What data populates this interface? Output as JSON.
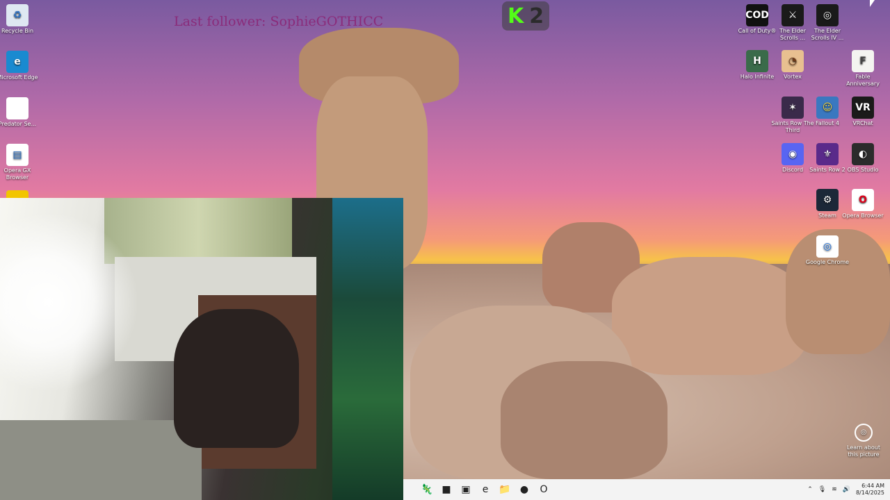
{
  "overlay": {
    "last_follower": "Last follower: SophieGOTHICC",
    "badge_letter": "K",
    "badge_number": "2"
  },
  "desktop_left": [
    {
      "label": "Recycle Bin",
      "icon": "recycle-bin-icon",
      "glyph": "♻",
      "bg": "#dfe8f2",
      "fg": "#2a72c8"
    },
    {
      "label": "Microsoft Edge",
      "icon": "edge-icon",
      "glyph": "e",
      "bg": "#1a8ad0",
      "fg": "#ffffff"
    },
    {
      "label": "Predator Se...",
      "icon": "file-icon",
      "glyph": "",
      "bg": "#ffffff",
      "fg": "#333333"
    },
    {
      "label": "Opera GX Browser",
      "icon": "opera-gx-icon",
      "glyph": "▤",
      "bg": "#ffffff",
      "fg": "#2a72c8"
    },
    {
      "label": "",
      "icon": "app-icon",
      "glyph": "✓",
      "bg": "#f2c500",
      "fg": "#222222"
    }
  ],
  "desktop_right": [
    {
      "label": "Call of Duty®",
      "icon": "call-of-duty-icon",
      "glyph": "COD",
      "bg": "#111111",
      "fg": "#ffffff"
    },
    {
      "label": "The Elder Scrolls ...",
      "icon": "elder-scrolls-skyrim-icon",
      "glyph": "⚔",
      "bg": "#1a1a1a",
      "fg": "#ffffff"
    },
    {
      "label": "The Elder Scrolls IV ...",
      "icon": "elder-scrolls-oblivion-icon",
      "glyph": "◎",
      "bg": "#1a1a1a",
      "fg": "#ffffff"
    },
    {
      "label": "Halo Infinite",
      "icon": "halo-infinite-icon",
      "glyph": "H",
      "bg": "#3a6b4a",
      "fg": "#ffffff"
    },
    {
      "label": "Vortex",
      "icon": "vortex-icon",
      "glyph": "◔",
      "bg": "#e8c090",
      "fg": "#6b3a1a"
    },
    {
      "label": "Fable Anniversary",
      "icon": "fable-icon",
      "glyph": "F",
      "bg": "#f4f4f0",
      "fg": "#444444"
    },
    {
      "label": "Saints Row The Third",
      "icon": "saints-row-third-icon",
      "glyph": "✶",
      "bg": "#3a2a4a",
      "fg": "#ffffff"
    },
    {
      "label": "Fallout 4",
      "icon": "fallout-4-icon",
      "glyph": "☺",
      "bg": "#3a78c0",
      "fg": "#f2d640"
    },
    {
      "label": "VRChat",
      "icon": "vrchat-icon",
      "glyph": "VR",
      "bg": "#1a1a1a",
      "fg": "#ffffff"
    },
    {
      "label": "Discord",
      "icon": "discord-icon",
      "glyph": "◉",
      "bg": "#5865f2",
      "fg": "#ffffff"
    },
    {
      "label": "Saints Row 2",
      "icon": "saints-row-2-icon",
      "glyph": "⚜",
      "bg": "#5a2a8a",
      "fg": "#ffffff"
    },
    {
      "label": "OBS Studio",
      "icon": "obs-studio-icon",
      "glyph": "◐",
      "bg": "#2b2b2b",
      "fg": "#ffffff"
    },
    {
      "label": "Steam",
      "icon": "steam-icon",
      "glyph": "⚙",
      "bg": "#1b2838",
      "fg": "#ffffff"
    },
    {
      "label": "Opera Browser",
      "icon": "opera-icon",
      "glyph": "O",
      "bg": "#ffffff",
      "fg": "#e0001a"
    },
    {
      "label": "Google Chrome",
      "icon": "chrome-icon",
      "glyph": "◎",
      "bg": "#ffffff",
      "fg": "#1a73e8"
    }
  ],
  "learn": {
    "label": "Learn about this picture"
  },
  "taskbar": {
    "apps": [
      {
        "name": "app-icon",
        "glyph": "🦎"
      },
      {
        "name": "task-view-icon",
        "glyph": "■"
      },
      {
        "name": "store-icon",
        "glyph": "▣"
      },
      {
        "name": "edge-icon",
        "glyph": "e"
      },
      {
        "name": "file-explorer-icon",
        "glyph": "📁"
      },
      {
        "name": "obs-icon",
        "glyph": "●"
      },
      {
        "name": "opera-icon",
        "glyph": "O"
      }
    ],
    "time": "6:44 AM",
    "date": "8/14/2025"
  }
}
